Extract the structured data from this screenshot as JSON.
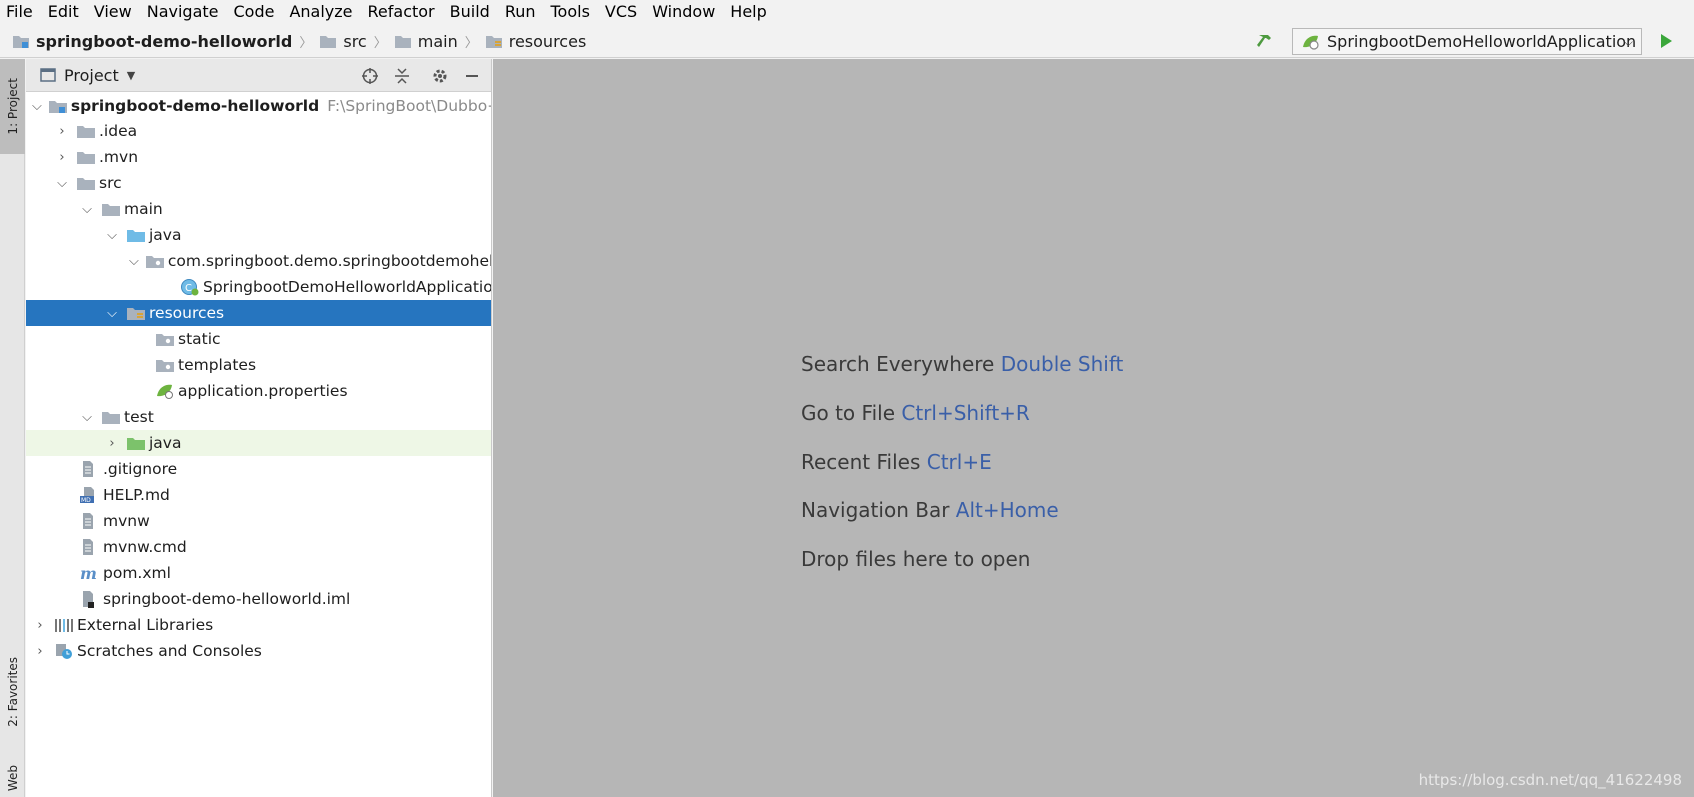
{
  "menu": [
    "File",
    "Edit",
    "View",
    "Navigate",
    "Code",
    "Analyze",
    "Refactor",
    "Build",
    "Run",
    "Tools",
    "VCS",
    "Window",
    "Help"
  ],
  "breadcrumb": [
    "springboot-demo-helloworld",
    "src",
    "main",
    "resources"
  ],
  "run_config": "SpringbootDemoHelloworldApplication",
  "strip": {
    "project": "1: Project",
    "favorites": "2: Favorites",
    "web": "Web"
  },
  "panel": {
    "title": "Project"
  },
  "tree": [
    {
      "label": "springboot-demo-helloworld",
      "hint": "F:\\SpringBoot\\Dubbo+Zo"
    },
    {
      "label": ".idea"
    },
    {
      "label": ".mvn"
    },
    {
      "label": "src"
    },
    {
      "label": "main"
    },
    {
      "label": "java"
    },
    {
      "label": "com.springboot.demo.springbootdemohel"
    },
    {
      "label": "SpringbootDemoHelloworldApplication"
    },
    {
      "label": "resources"
    },
    {
      "label": "static"
    },
    {
      "label": "templates"
    },
    {
      "label": "application.properties"
    },
    {
      "label": "test"
    },
    {
      "label": "java"
    },
    {
      "label": ".gitignore"
    },
    {
      "label": "HELP.md"
    },
    {
      "label": "mvnw"
    },
    {
      "label": "mvnw.cmd"
    },
    {
      "label": "pom.xml"
    },
    {
      "label": "springboot-demo-helloworld.iml"
    },
    {
      "label": "External Libraries"
    },
    {
      "label": "Scratches and Consoles"
    }
  ],
  "hints": [
    {
      "text": "Search Everywhere",
      "key": "Double Shift"
    },
    {
      "text": "Go to File",
      "key": "Ctrl+Shift+R"
    },
    {
      "text": "Recent Files",
      "key": "Ctrl+E"
    },
    {
      "text": "Navigation Bar",
      "key": "Alt+Home"
    },
    {
      "text": "Drop files here to open",
      "key": ""
    }
  ],
  "watermark": "https://blog.csdn.net/qq_41622498",
  "colors": {
    "selection": "#2675bf",
    "editor_bg": "#b6b6b6",
    "hint_key": "#3a5fa8",
    "folder": "#a9b2bd",
    "source_folder": "#6fbbe6",
    "test_folder": "#7cc26b"
  }
}
